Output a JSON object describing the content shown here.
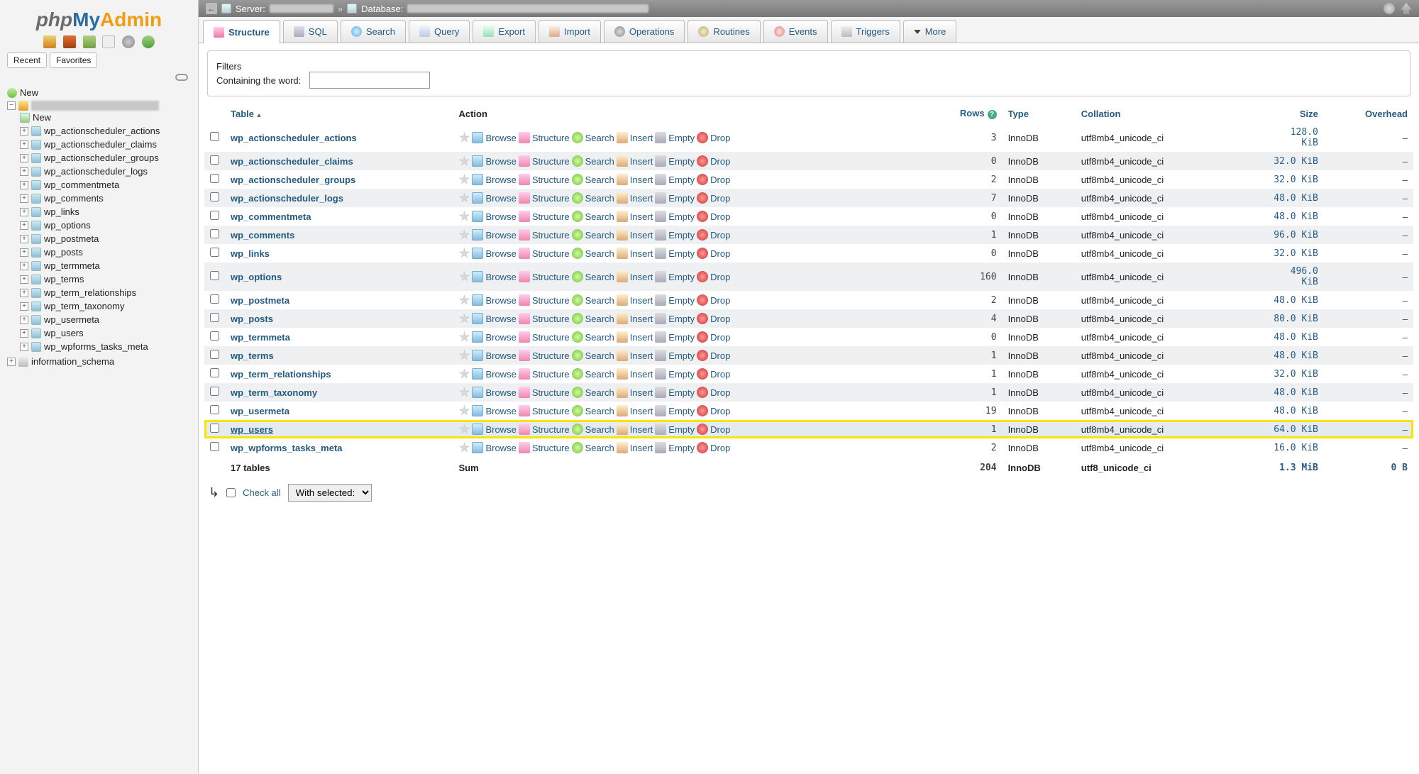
{
  "logo": {
    "p1": "php",
    "p2": "My",
    "p3": "Admin"
  },
  "sidebar_tabs": {
    "recent": "Recent",
    "favorites": "Favorites"
  },
  "tree": {
    "new": "New",
    "db_new": "New",
    "tables": [
      "wp_actionscheduler_actions",
      "wp_actionscheduler_claims",
      "wp_actionscheduler_groups",
      "wp_actionscheduler_logs",
      "wp_commentmeta",
      "wp_comments",
      "wp_links",
      "wp_options",
      "wp_postmeta",
      "wp_posts",
      "wp_termmeta",
      "wp_terms",
      "wp_term_relationships",
      "wp_term_taxonomy",
      "wp_usermeta",
      "wp_users",
      "wp_wpforms_tasks_meta"
    ],
    "info_schema": "information_schema"
  },
  "breadcrumb": {
    "server": "Server:",
    "database": "Database:"
  },
  "tabs": [
    "Structure",
    "SQL",
    "Search",
    "Query",
    "Export",
    "Import",
    "Operations",
    "Routines",
    "Events",
    "Triggers",
    "More"
  ],
  "filters": {
    "legend": "Filters",
    "label": "Containing the word:"
  },
  "columns": {
    "table": "Table",
    "action": "Action",
    "rows": "Rows",
    "type": "Type",
    "collation": "Collation",
    "size": "Size",
    "overhead": "Overhead"
  },
  "row_actions": {
    "browse": "Browse",
    "structure": "Structure",
    "search": "Search",
    "insert": "Insert",
    "empty": "Empty",
    "drop": "Drop"
  },
  "rows": [
    {
      "name": "wp_actionscheduler_actions",
      "rows": 3,
      "type": "InnoDB",
      "coll": "utf8mb4_unicode_ci",
      "size": "128.0\n  KiB",
      "ov": "–"
    },
    {
      "name": "wp_actionscheduler_claims",
      "rows": 0,
      "type": "InnoDB",
      "coll": "utf8mb4_unicode_ci",
      "size": "32.0 KiB",
      "ov": "–"
    },
    {
      "name": "wp_actionscheduler_groups",
      "rows": 2,
      "type": "InnoDB",
      "coll": "utf8mb4_unicode_ci",
      "size": "32.0 KiB",
      "ov": "–"
    },
    {
      "name": "wp_actionscheduler_logs",
      "rows": 7,
      "type": "InnoDB",
      "coll": "utf8mb4_unicode_ci",
      "size": "48.0 KiB",
      "ov": "–"
    },
    {
      "name": "wp_commentmeta",
      "rows": 0,
      "type": "InnoDB",
      "coll": "utf8mb4_unicode_ci",
      "size": "48.0 KiB",
      "ov": "–"
    },
    {
      "name": "wp_comments",
      "rows": 1,
      "type": "InnoDB",
      "coll": "utf8mb4_unicode_ci",
      "size": "96.0 KiB",
      "ov": "–"
    },
    {
      "name": "wp_links",
      "rows": 0,
      "type": "InnoDB",
      "coll": "utf8mb4_unicode_ci",
      "size": "32.0 KiB",
      "ov": "–"
    },
    {
      "name": "wp_options",
      "rows": 160,
      "type": "InnoDB",
      "coll": "utf8mb4_unicode_ci",
      "size": "496.0\n  KiB",
      "ov": "–"
    },
    {
      "name": "wp_postmeta",
      "rows": 2,
      "type": "InnoDB",
      "coll": "utf8mb4_unicode_ci",
      "size": "48.0 KiB",
      "ov": "–"
    },
    {
      "name": "wp_posts",
      "rows": 4,
      "type": "InnoDB",
      "coll": "utf8mb4_unicode_ci",
      "size": "80.0 KiB",
      "ov": "–"
    },
    {
      "name": "wp_termmeta",
      "rows": 0,
      "type": "InnoDB",
      "coll": "utf8mb4_unicode_ci",
      "size": "48.0 KiB",
      "ov": "–"
    },
    {
      "name": "wp_terms",
      "rows": 1,
      "type": "InnoDB",
      "coll": "utf8mb4_unicode_ci",
      "size": "48.0 KiB",
      "ov": "–"
    },
    {
      "name": "wp_term_relationships",
      "rows": 1,
      "type": "InnoDB",
      "coll": "utf8mb4_unicode_ci",
      "size": "32.0 KiB",
      "ov": "–"
    },
    {
      "name": "wp_term_taxonomy",
      "rows": 1,
      "type": "InnoDB",
      "coll": "utf8mb4_unicode_ci",
      "size": "48.0 KiB",
      "ov": "–"
    },
    {
      "name": "wp_usermeta",
      "rows": 19,
      "type": "InnoDB",
      "coll": "utf8mb4_unicode_ci",
      "size": "48.0 KiB",
      "ov": "–"
    },
    {
      "name": "wp_users",
      "rows": 1,
      "type": "InnoDB",
      "coll": "utf8mb4_unicode_ci",
      "size": "64.0 KiB",
      "ov": "–",
      "hl": true
    },
    {
      "name": "wp_wpforms_tasks_meta",
      "rows": 2,
      "type": "InnoDB",
      "coll": "utf8mb4_unicode_ci",
      "size": "16.0 KiB",
      "ov": "–"
    }
  ],
  "sum": {
    "label": "17 tables",
    "action": "Sum",
    "rows": 204,
    "type": "InnoDB",
    "coll": "utf8_unicode_ci",
    "size": "1.3 MiB",
    "ov": "0 B"
  },
  "bottom": {
    "check_all": "Check all",
    "with_selected": "With selected:"
  }
}
